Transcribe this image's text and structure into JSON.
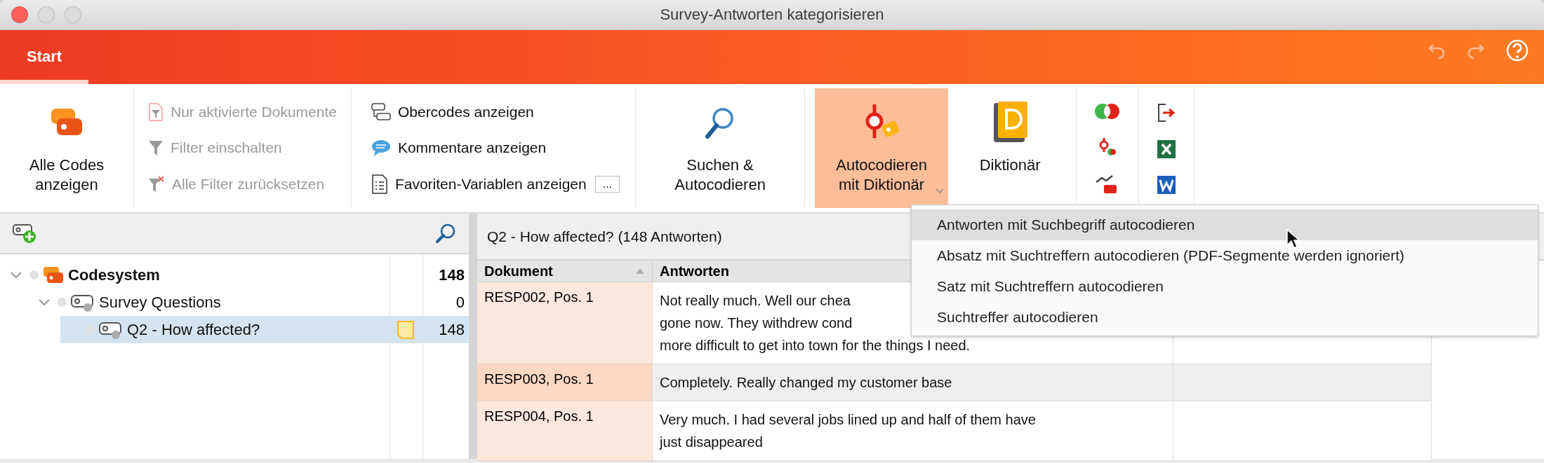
{
  "window": {
    "title": "Survey-Antworten kategorisieren"
  },
  "ribbon_tabs": [
    {
      "label": "Start",
      "selected": true
    }
  ],
  "quick_actions": {
    "undo": {
      "disabled": true
    },
    "redo": {
      "disabled": true
    }
  },
  "ribbon": {
    "show_all_codes": {
      "label": "Alle Codes anzeigen"
    },
    "filter_items": [
      {
        "label": "Nur aktivierte Dokumente",
        "disabled": true
      },
      {
        "label": "Filter einschalten",
        "disabled": true
      },
      {
        "label": "Alle Filter zurücksetzen",
        "disabled": true
      }
    ],
    "view_items": [
      {
        "label": "Obercodes anzeigen"
      },
      {
        "label": "Kommentare anzeigen"
      },
      {
        "label": "Favoriten-Variablen anzeigen",
        "more_button": "..."
      }
    ],
    "search_autocode": {
      "label": "Suchen & Autocodieren"
    },
    "autocode_dictionary": {
      "label": "Autocodieren mit Diktionär",
      "expanded": true
    },
    "dictionary": {
      "label": "Diktionär"
    }
  },
  "code_system": {
    "tree": [
      {
        "label": "Codesystem",
        "kind": "root",
        "count": "148",
        "expanded": true,
        "selected": false,
        "memo": false,
        "children": [
          {
            "label": "Survey Questions",
            "kind": "code",
            "count": "0",
            "expanded": true,
            "selected": false,
            "memo": false,
            "children": [
              {
                "label": "Q2 - How affected?",
                "kind": "code",
                "count": "148",
                "selected": true,
                "memo": true
              }
            ]
          }
        ]
      }
    ]
  },
  "responses": {
    "title": "Q2 - How affected? (148 Antworten)",
    "columns": [
      {
        "label": "Dokument",
        "sorted": true
      },
      {
        "label": "Antworten",
        "sorted": false
      }
    ],
    "rows": [
      {
        "document": "RESP002, Pos. 1",
        "lines": [
          "Not really much. Well our chea",
          "gone now. They withdrew cond",
          "more difficult to get into town for the things I need."
        ],
        "selected": false
      },
      {
        "document": "RESP003, Pos. 1",
        "lines": [
          "Completely. Really changed my customer base"
        ],
        "selected": true
      },
      {
        "document": "RESP004, Pos. 1",
        "lines": [
          "Very much. I had several jobs lined up and half of them have",
          "just disappeared"
        ],
        "selected": false
      }
    ]
  },
  "dropdown_menu": {
    "items": [
      {
        "label": "Antworten mit Suchbegriff autocodieren",
        "selected": true
      },
      {
        "label": "Absatz mit Suchtreffern autocodieren (PDF-Segmente werden ignoriert)",
        "selected": false
      },
      {
        "label": "Satz mit Suchtreffern autocodieren",
        "selected": false
      },
      {
        "label": "Suchtreffer autocodieren",
        "selected": false
      }
    ]
  }
}
